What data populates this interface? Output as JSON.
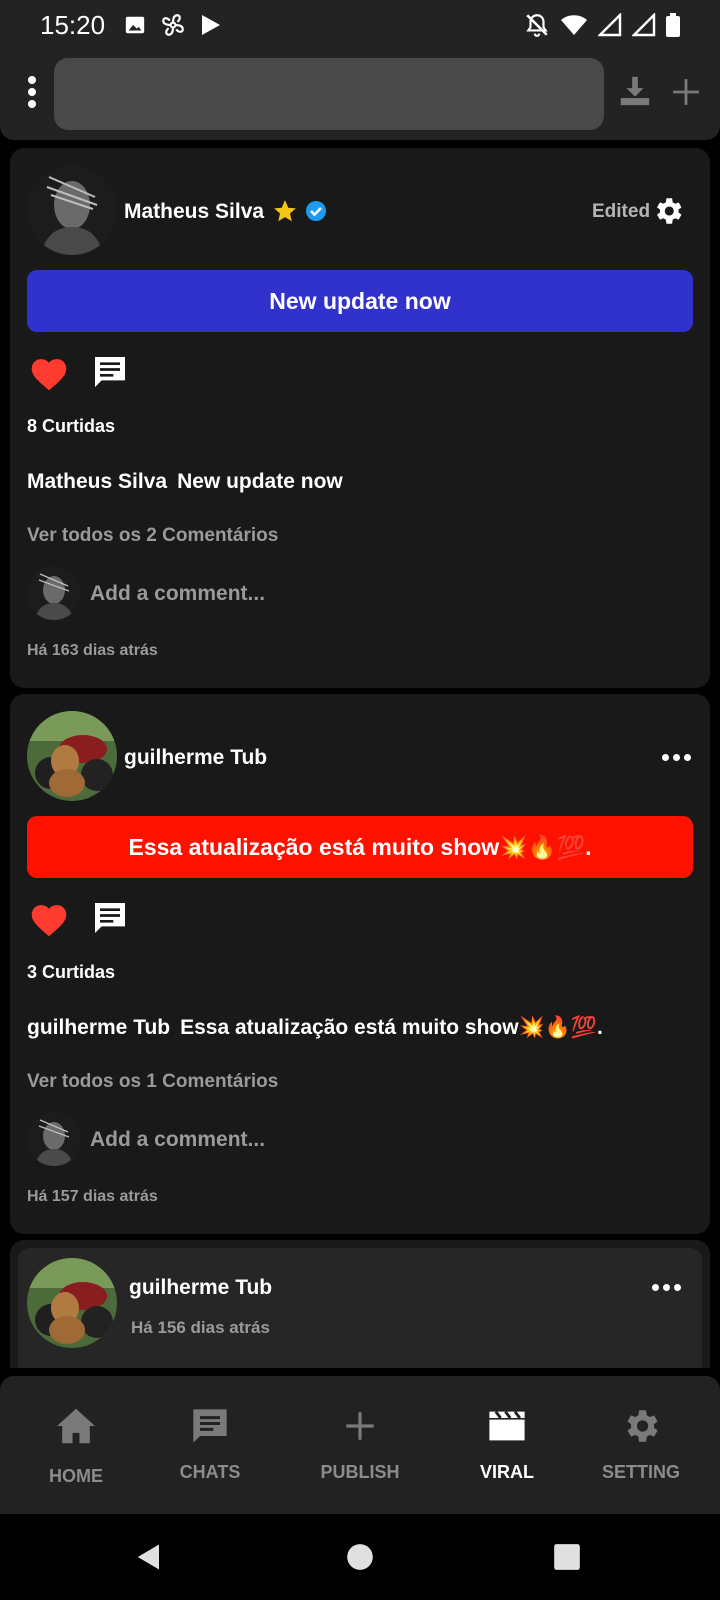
{
  "status_bar": {
    "time": "15:20"
  },
  "top_bar": {
    "search_value": ""
  },
  "posts": [
    {
      "author": "Matheus Silva",
      "edited": "Edited",
      "banner_text": "New update now",
      "banner_color": "#3131cc",
      "likes": "8 Curtidas",
      "caption_author": "Matheus Silva",
      "caption_text": "New update now",
      "view_comments": "Ver todos os 2 Comentários",
      "comment_placeholder": "Add a comment...",
      "timestamp": "Há 163 dias atrás"
    },
    {
      "author": "guilherme Tub",
      "banner_text": "Essa atualização está muito show💥🔥💯.",
      "banner_color": "#ff1100",
      "likes": "3 Curtidas",
      "caption_author": "guilherme Tub",
      "caption_text": "Essa atualização está muito show💥🔥💯.",
      "view_comments": "Ver todos os 1 Comentários",
      "comment_placeholder": "Add a comment...",
      "timestamp": "Há 157 dias atrás"
    },
    {
      "author": "guilherme Tub",
      "timestamp": "Há 156 dias atrás"
    }
  ],
  "bottom_nav": {
    "items": [
      {
        "label": "HOME",
        "icon": "home-icon"
      },
      {
        "label": "CHATS",
        "icon": "chat-icon"
      },
      {
        "label": "PUBLISH",
        "icon": "plus-icon"
      },
      {
        "label": "VIRAL",
        "icon": "clapperboard-icon",
        "active": true
      },
      {
        "label": "SETTING",
        "icon": "gear-icon"
      }
    ]
  },
  "colors": {
    "accent_blue": "#3131cc",
    "accent_red": "#ff1100",
    "heart": "#ff3b30",
    "verified": "#1d9bf0",
    "star": "#f5c518"
  }
}
